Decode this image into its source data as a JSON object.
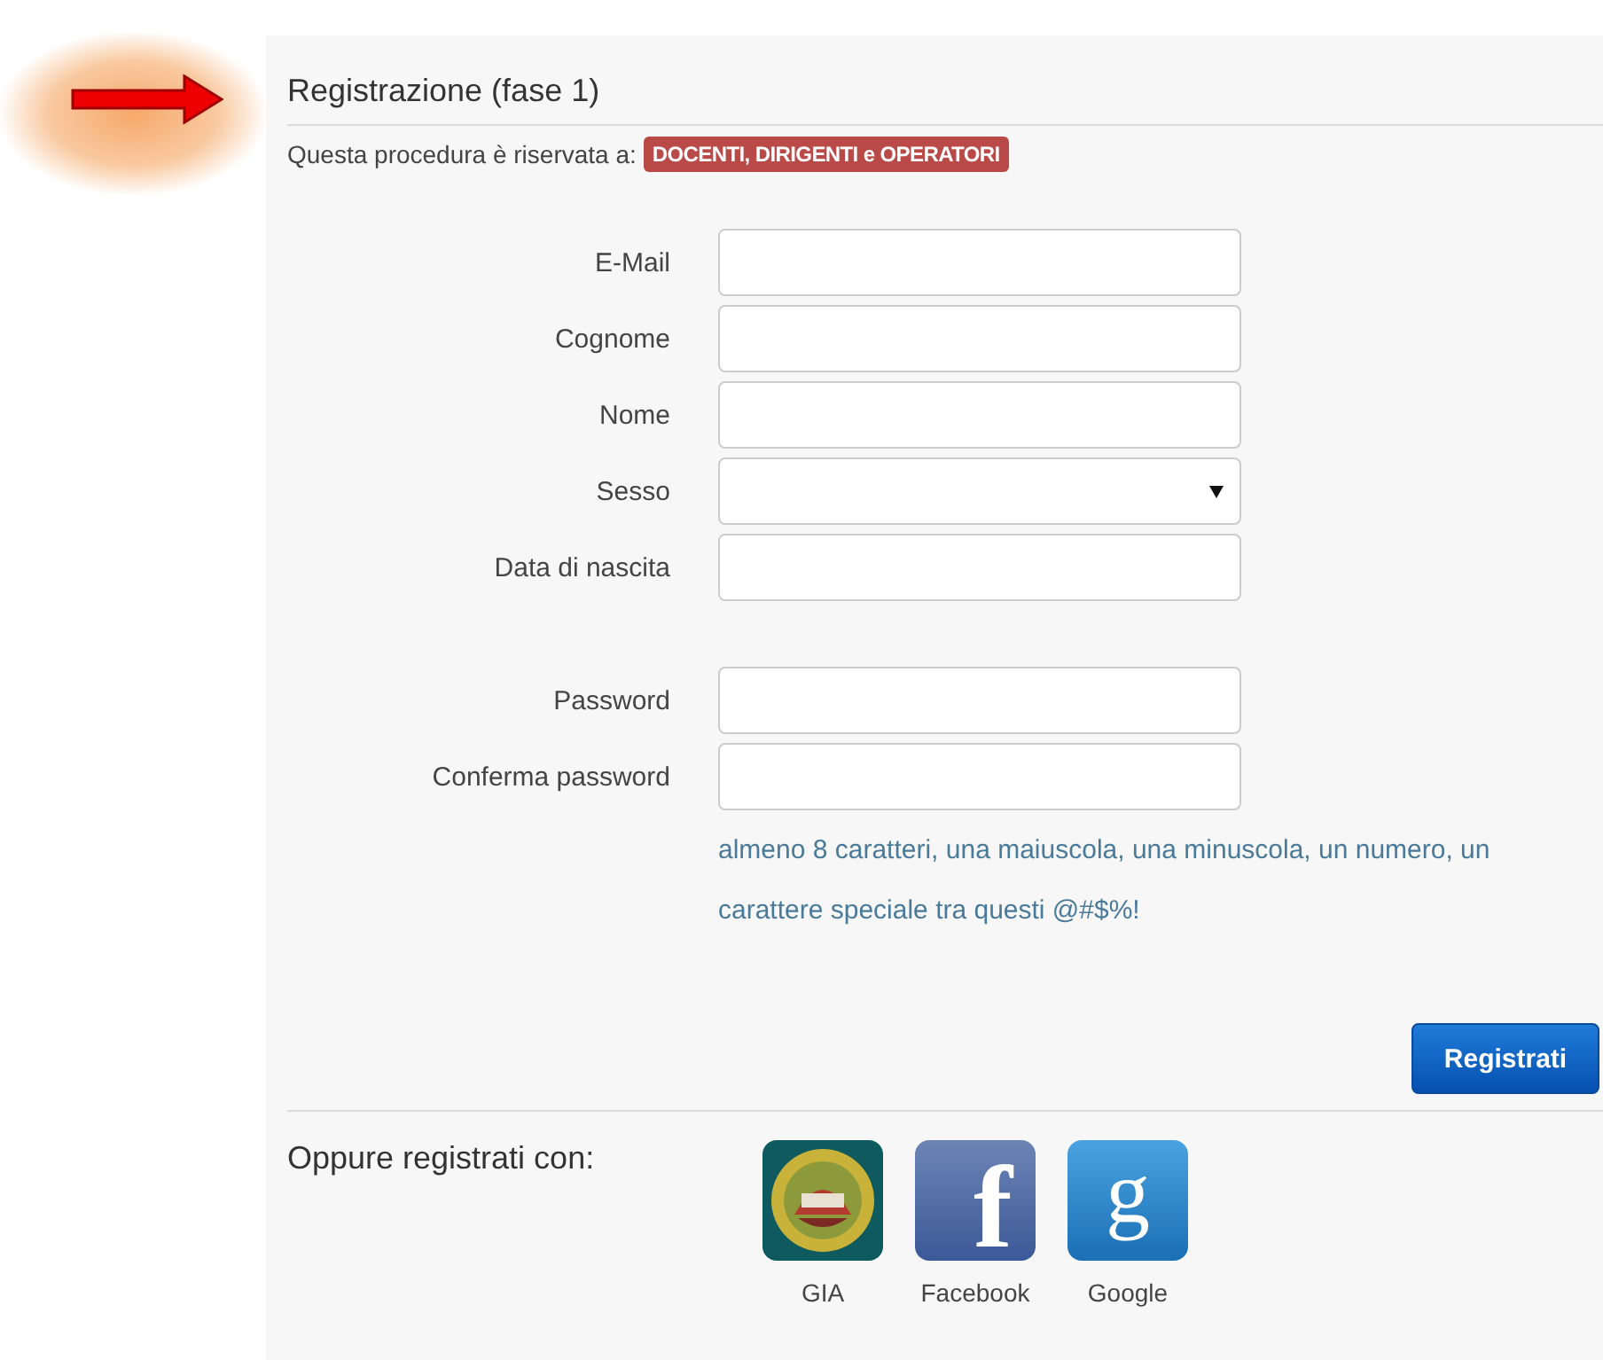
{
  "title": "Registrazione (fase 1)",
  "intro": {
    "text": "Questa procedura è riservata a:",
    "badge": "DOCENTI, DIRIGENTI e OPERATORI"
  },
  "personal_fields": [
    {
      "label": "E-Mail",
      "kind": "text"
    },
    {
      "label": "Cognome",
      "kind": "text"
    },
    {
      "label": "Nome",
      "kind": "text"
    },
    {
      "label": "Sesso",
      "kind": "select"
    },
    {
      "label": "Data di nascita",
      "kind": "text"
    }
  ],
  "password_fields": [
    {
      "label": "Password"
    },
    {
      "label": "Conferma password"
    }
  ],
  "password_hint": "almeno 8 caratteri, una maiuscola, una minuscola, un numero, un carattere speciale tra questi @#$%!",
  "submit": "Registrati",
  "social": {
    "label": "Oppure registrati con:",
    "providers": [
      {
        "name": "GIA",
        "kind": "seal"
      },
      {
        "name": "Facebook",
        "kind": "letter",
        "glyph": "f"
      },
      {
        "name": "Google",
        "kind": "letter",
        "glyph": "g"
      }
    ]
  }
}
